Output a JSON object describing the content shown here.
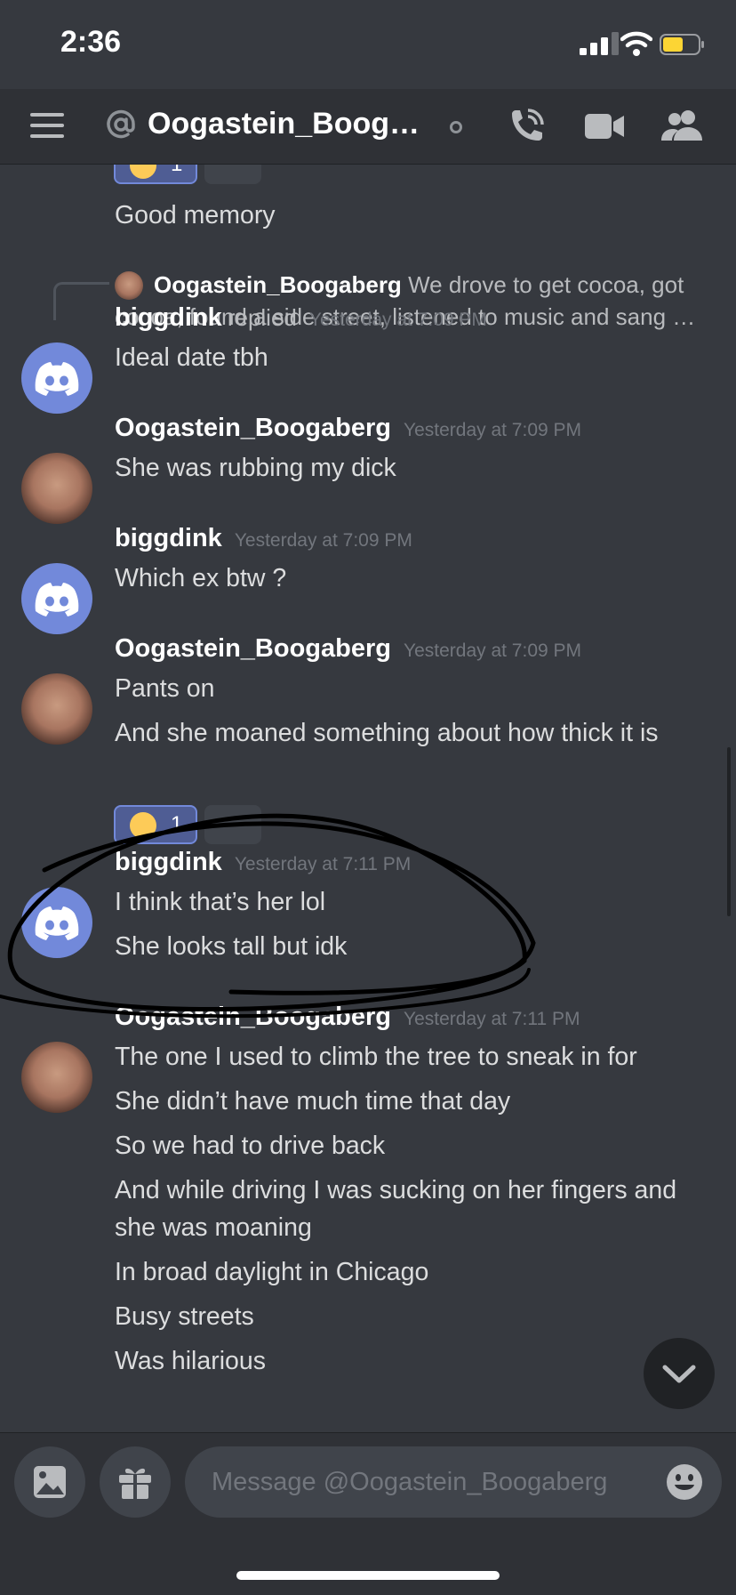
{
  "status_bar": {
    "time": "2:36"
  },
  "header": {
    "title": "Oogastein_Boogab…"
  },
  "prev_message": {
    "text": "Good memory",
    "reaction_count": "1"
  },
  "reply": {
    "author": "Oogastein_Boogaberg",
    "text": "We drove to get cocoa, got cocoa, found a side street, listened to music and sang …"
  },
  "messages": [
    {
      "author": "biggdink",
      "replied": "replied",
      "timestamp": "Yesterday at 7:09 PM",
      "lines": [
        "Ideal date tbh"
      ]
    },
    {
      "author": "Oogastein_Boogaberg",
      "timestamp": "Yesterday at 7:09 PM",
      "lines": [
        "She was rubbing my dick"
      ]
    },
    {
      "author": "biggdink",
      "timestamp": "Yesterday at 7:09 PM",
      "lines": [
        "Which ex btw ?"
      ]
    },
    {
      "author": "Oogastein_Boogaberg",
      "timestamp": "Yesterday at 7:09 PM",
      "lines": [
        "Pants on",
        "And she moaned something about how thick it is"
      ],
      "reaction_count": "1"
    },
    {
      "author": "biggdink",
      "timestamp": "Yesterday at 7:11 PM",
      "lines": [
        "I think that’s her lol",
        "She looks tall but idk"
      ]
    },
    {
      "author": "Oogastein_Boogaberg",
      "timestamp": "Yesterday at 7:11 PM",
      "lines": [
        "The one I used to climb the tree to sneak in for",
        "She didn’t have much time that day",
        "So we had to drive back",
        "And while driving I was sucking on her fingers and she was moaning",
        "In broad daylight in Chicago",
        "Busy streets",
        "Was hilarious"
      ]
    }
  ],
  "input": {
    "placeholder": "Message @Oogastein_Boogaberg"
  },
  "colors": {
    "background": "#36393f",
    "header": "#2f3136",
    "blurple": "#7289da",
    "timestamp": "#72767d"
  },
  "icons": [
    "hamburger-icon",
    "at-icon",
    "call-icon",
    "video-icon",
    "members-icon",
    "image-icon",
    "gift-icon",
    "emoji-icon",
    "chevron-down-icon"
  ]
}
